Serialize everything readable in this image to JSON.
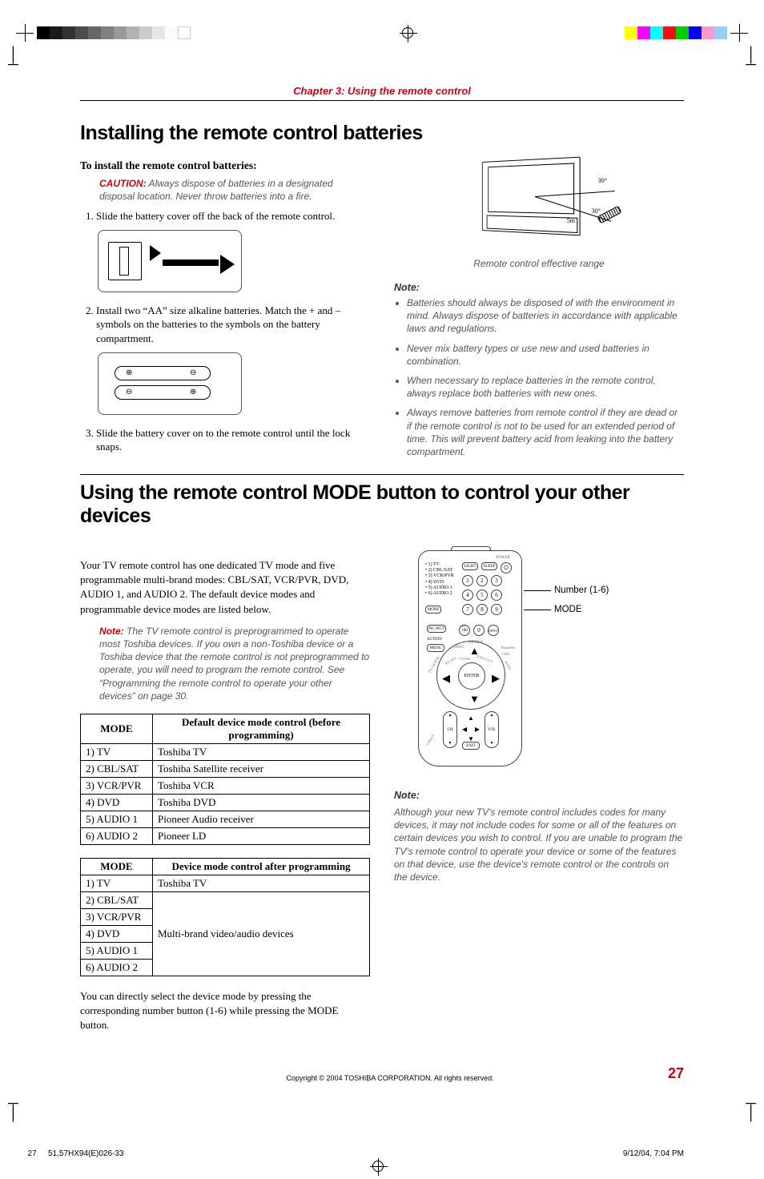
{
  "chapter": "Chapter 3: Using the remote control",
  "h1a": "Installing the remote control batteries",
  "install_head": "To install the remote control batteries:",
  "caution_label": "CAUTION:",
  "caution_text": " Always dispose of batteries in a designated disposal location. Never throw batteries into a fire.",
  "steps": {
    "s1": "Slide the battery cover off the back of the remote control.",
    "s2": "Install two “AA” size alkaline batteries. Match the + and – symbols on the batteries to the symbols on the battery compartment.",
    "s3": "Slide the battery cover on to the remote control until the lock snaps."
  },
  "range_caption": "Remote control effective range",
  "note_label": "Note:",
  "note_bullets": {
    "b1": "Batteries should always be disposed of with the environment in mind. Always dispose of batteries in accordance with applicable laws and regulations.",
    "b2": "Never mix battery types or use new and used batteries in combination.",
    "b3": "When necessary to replace batteries in the remote control, always replace both batteries with new ones.",
    "b4": "Always remove batteries from remote control if they are dead or if the remote control is not to be used for an extended period of time. This will prevent battery acid from leaking into the battery compartment."
  },
  "h1b": "Using the remote control MODE button to control your other devices",
  "intro": "Your TV remote control has one dedicated TV mode and five programmable multi-brand modes: CBL/SAT, VCR/PVR, DVD, AUDIO 1, and AUDIO 2. The default device modes and programmable device modes are listed below.",
  "note2_label": "Note:",
  "note2_text": " The TV remote control is preprogrammed to operate most Toshiba devices. If you own a non-Toshiba device or a Toshiba device that the remote control is not preprogrammed to operate, you will need to program the remote control. See “Programming the remote control to operate your other devices” on page 30.",
  "table1": {
    "h1": "MODE",
    "h2": "Default device mode control (before programming)",
    "r1c1": "1) TV",
    "r1c2": "Toshiba TV",
    "r2c1": "2) CBL/SAT",
    "r2c2": "Toshiba Satellite receiver",
    "r3c1": "3) VCR/PVR",
    "r3c2": "Toshiba VCR",
    "r4c1": "4) DVD",
    "r4c2": "Toshiba  DVD",
    "r5c1": "5) AUDIO 1",
    "r5c2": "Pioneer Audio receiver",
    "r6c1": "6) AUDIO 2",
    "r6c2": "Pioneer LD"
  },
  "table2": {
    "h1": "MODE",
    "h2": "Device mode control after programming",
    "r1c1": "1) TV",
    "r1c2": "Toshiba TV",
    "r2c1": "2) CBL/SAT",
    "r3c1": "3) VCR/PVR",
    "r4c1": "4) DVD",
    "mergec2": "Multi-brand video/audio devices",
    "r5c1": "5) AUDIO 1",
    "r6c1": "6) AUDIO 2"
  },
  "after_para": "You can directly select the device mode by pressing the corresponding number button (1-6) while pressing the MODE button.",
  "remote_modes": {
    "m1": "1) TV",
    "m2": "2) CBL/SAT",
    "m3": "3) VCR/PVR",
    "m4": "4) DVD",
    "m5": "5) AUDIO 1",
    "m6": "6) AUDIO 2"
  },
  "remote_buttons": {
    "light": "LIGHT",
    "sleep": "SLEEP",
    "power": "POWER",
    "mode": "MODE",
    "pixpict": "PIC PICT",
    "plus10": "+10",
    "hundred": "100",
    "input": "INPUT",
    "action": "ACTION",
    "menu": "MENU",
    "info": "INFO",
    "device": "DEVICE",
    "theaternet": "TheaterNet",
    "ctrl": "CTRL",
    "tvguide": "TV GUIDE",
    "recall": "RECALL",
    "vtitle": "V.TITLE",
    "dvdtitle": "DVD TITLE",
    "audio": "AUDIO",
    "enter": "ENTER",
    "ch": "CH",
    "vol": "VOL",
    "exit": "EXIT",
    "timage": "T.IMAGE"
  },
  "remote_callouts": {
    "numbers": "Number (1-6)",
    "mode": "MODE"
  },
  "note3_label": "Note:",
  "note3_text": "Although your new TV's remote control includes codes for many devices, it may not include codes for some or all of the features on certain devices you wish to control. If you are unable to program the TV's remote control to operate your device or some of the features on that device, use the device's remote control or the controls on the device.",
  "copyright": "Copyright © 2004 TOSHIBA CORPORATION. All rights reserved.",
  "pageno": "27",
  "slug_file": "51,57HX94(E)026-33",
  "slug_page": "27",
  "slug_date": "9/12/04, 7:04 PM"
}
